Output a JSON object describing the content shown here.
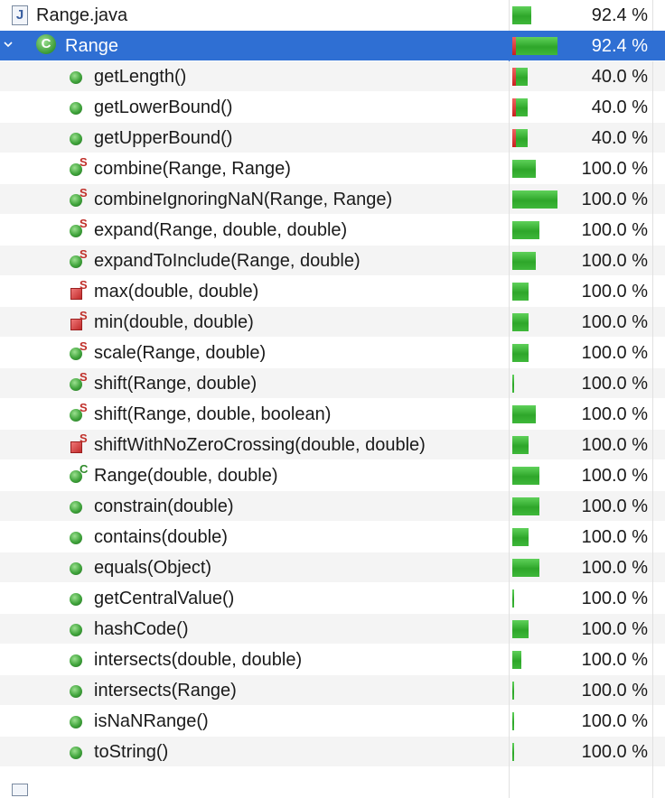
{
  "colors": {
    "selected": "#2f6fd3",
    "covered": "#3fb83a",
    "missed": "#d23030"
  },
  "file_row": {
    "icon": "java-file-icon",
    "label": "Range.java",
    "percent": "92.4 %",
    "coverage": 0.924
  },
  "class_row": {
    "icon": "class-icon",
    "icon_letter": "C",
    "label": "Range",
    "percent": "92.4 %",
    "coverage": 0.924,
    "expanded": true
  },
  "methods": [
    {
      "label": "getLength()",
      "percent": "40.0 %",
      "icon": "public-method-icon",
      "modifier": ""
    },
    {
      "label": "getLowerBound()",
      "percent": "40.0 %",
      "icon": "public-method-icon",
      "modifier": ""
    },
    {
      "label": "getUpperBound()",
      "percent": "40.0 %",
      "icon": "public-method-icon",
      "modifier": ""
    },
    {
      "label": "combine(Range, Range)",
      "percent": "100.0 %",
      "icon": "public-method-icon",
      "modifier": "S"
    },
    {
      "label": "combineIgnoringNaN(Range, Range)",
      "percent": "100.0 %",
      "icon": "public-method-icon",
      "modifier": "S"
    },
    {
      "label": "expand(Range, double, double)",
      "percent": "100.0 %",
      "icon": "public-method-icon",
      "modifier": "S"
    },
    {
      "label": "expandToInclude(Range, double)",
      "percent": "100.0 %",
      "icon": "public-method-icon",
      "modifier": "S"
    },
    {
      "label": "max(double, double)",
      "percent": "100.0 %",
      "icon": "private-method-icon",
      "modifier": "S"
    },
    {
      "label": "min(double, double)",
      "percent": "100.0 %",
      "icon": "private-method-icon",
      "modifier": "S"
    },
    {
      "label": "scale(Range, double)",
      "percent": "100.0 %",
      "icon": "public-method-icon",
      "modifier": "S"
    },
    {
      "label": "shift(Range, double)",
      "percent": "100.0 %",
      "icon": "public-method-icon",
      "modifier": "S"
    },
    {
      "label": "shift(Range, double, boolean)",
      "percent": "100.0 %",
      "icon": "public-method-icon",
      "modifier": "S"
    },
    {
      "label": "shiftWithNoZeroCrossing(double, double)",
      "percent": "100.0 %",
      "icon": "private-method-icon",
      "modifier": "S"
    },
    {
      "label": "Range(double, double)",
      "percent": "100.0 %",
      "icon": "public-method-icon",
      "modifier": "C"
    },
    {
      "label": "constrain(double)",
      "percent": "100.0 %",
      "icon": "public-method-icon",
      "modifier": ""
    },
    {
      "label": "contains(double)",
      "percent": "100.0 %",
      "icon": "public-method-icon",
      "modifier": ""
    },
    {
      "label": "equals(Object)",
      "percent": "100.0 %",
      "icon": "public-method-icon",
      "modifier": ""
    },
    {
      "label": "getCentralValue()",
      "percent": "100.0 %",
      "icon": "public-method-icon",
      "modifier": ""
    },
    {
      "label": "hashCode()",
      "percent": "100.0 %",
      "icon": "public-method-icon",
      "modifier": ""
    },
    {
      "label": "intersects(double, double)",
      "percent": "100.0 %",
      "icon": "public-method-icon",
      "modifier": ""
    },
    {
      "label": "intersects(Range)",
      "percent": "100.0 %",
      "icon": "public-method-icon",
      "modifier": ""
    },
    {
      "label": "isNaNRange()",
      "percent": "100.0 %",
      "icon": "public-method-icon",
      "modifier": ""
    },
    {
      "label": "toString()",
      "percent": "100.0 %",
      "icon": "public-method-icon",
      "modifier": ""
    }
  ]
}
